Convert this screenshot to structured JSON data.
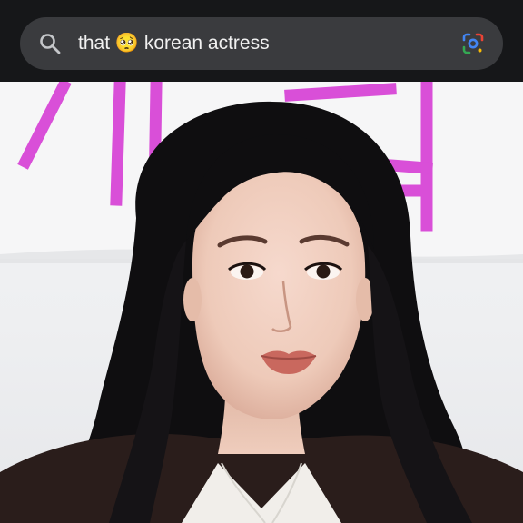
{
  "search": {
    "query": "that 🥺 korean actress"
  },
  "icons": {
    "left": "search-icon",
    "right": "google-lens-icon"
  },
  "colors": {
    "bar_bg": "#161719",
    "field_bg": "#3a3b3e",
    "text": "#f1f1f1",
    "sign_pink": "#d94fd8"
  }
}
